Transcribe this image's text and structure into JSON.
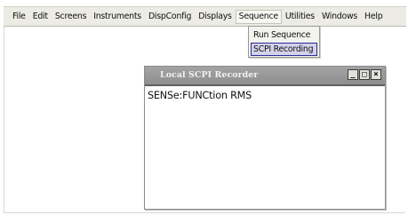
{
  "menu": {
    "items": [
      "File",
      "Edit",
      "Screens",
      "Instruments",
      "DispConfig",
      "Displays",
      "Sequence",
      "Utilities",
      "Windows",
      "Help"
    ],
    "open_index": 6
  },
  "sequence_dropdown": {
    "items": [
      "Run Sequence",
      "SCPI Recording"
    ],
    "highlighted_index": 1
  },
  "recorder_window": {
    "title": "Local SCPI Recorder",
    "buttons": {
      "minimize": "_",
      "maximize": "□",
      "close": "×"
    },
    "content": "SENSe:FUNCtion RMS"
  }
}
